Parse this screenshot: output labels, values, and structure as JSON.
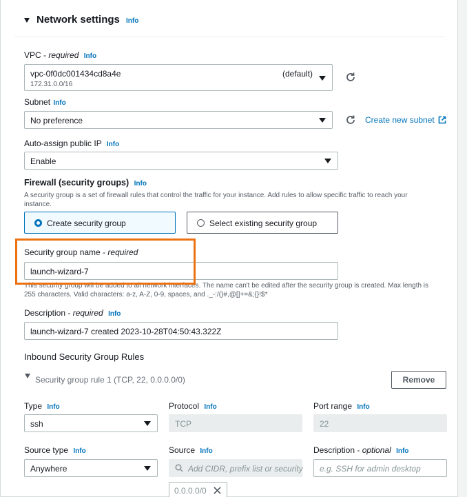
{
  "section": {
    "title": "Network settings",
    "info": "Info"
  },
  "vpc": {
    "label": "VPC",
    "required": "required",
    "info": "Info",
    "value": "vpc-0f0dc001434cd8a4e",
    "badge": "(default)",
    "cidr": "172.31.0.0/16"
  },
  "subnet": {
    "label": "Subnet",
    "info": "Info",
    "value": "No preference",
    "create_link": "Create new subnet"
  },
  "public_ip": {
    "label": "Auto-assign public IP",
    "info": "Info",
    "value": "Enable"
  },
  "firewall": {
    "title": "Firewall (security groups)",
    "info": "Info",
    "desc_line1": "A security group is a set of firewall rules that control the traffic for your instance. Add rules to allow specific traffic to reach your",
    "desc_line2": "instance.",
    "opt_create": "Create security group",
    "opt_select": "Select existing security group"
  },
  "sg_name": {
    "label": "Security group name",
    "required": "required",
    "value": "launch-wizard-7",
    "help_line1": "This security group will be added to all network interfaces. The name can't be edited after the security group is created. Max length is",
    "help_line2": "255 characters. Valid characters: a-z, A-Z, 0-9, spaces, and ._-:/()#,@[]+=&;{}!$*"
  },
  "description": {
    "label": "Description",
    "required": "required",
    "info": "Info",
    "value": "launch-wizard-7 created 2023-10-28T04:50:43.322Z"
  },
  "inbound": {
    "title": "Inbound Security Group Rules",
    "rule_title": "Security group rule 1 (TCP, 22, 0.0.0.0/0)",
    "remove": "Remove",
    "type_label": "Type",
    "type_value": "ssh",
    "protocol_label": "Protocol",
    "protocol_value": "TCP",
    "port_label": "Port range",
    "port_value": "22",
    "source_type_label": "Source type",
    "source_type_value": "Anywhere",
    "source_label": "Source",
    "source_placeholder": "Add CIDR, prefix list or security",
    "desc_label": "Description",
    "desc_optional": "optional",
    "desc_placeholder": "e.g. SSH for admin desktop",
    "token": "0.0.0.0/0",
    "info": "Info"
  },
  "colors": {
    "link": "#0073bb",
    "highlight": "#ec7211",
    "selected_bg": "#f1faff"
  }
}
